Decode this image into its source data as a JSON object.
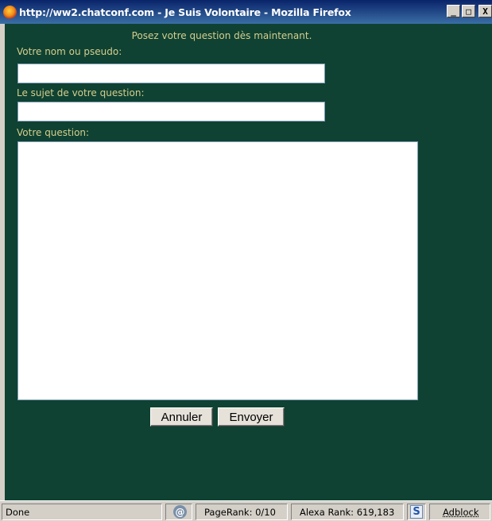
{
  "window": {
    "title": "http://ww2.chatconf.com - Je Suis Volontaire - Mozilla Firefox",
    "minimize_glyph": "_",
    "maximize_glyph": "□",
    "close_glyph": "X"
  },
  "form": {
    "heading": "Posez votre question dès maintenant.",
    "name_label": "Votre nom ou pseudo:",
    "name_value": "",
    "subject_label": "Le sujet de votre question:",
    "subject_value": "",
    "question_label": "Votre question:",
    "question_value": "",
    "cancel_button": "Annuler",
    "send_button": "Envoyer"
  },
  "statusbar": {
    "status": "Done",
    "at_icon_glyph": "@",
    "pagerank": "PageRank: 0/10",
    "alexa": "Alexa Rank: 619,183",
    "s_icon_glyph": "S",
    "adblock": "Adblock"
  },
  "colors": {
    "page_background": "#0f4232",
    "label_text": "#d6ce8e"
  }
}
